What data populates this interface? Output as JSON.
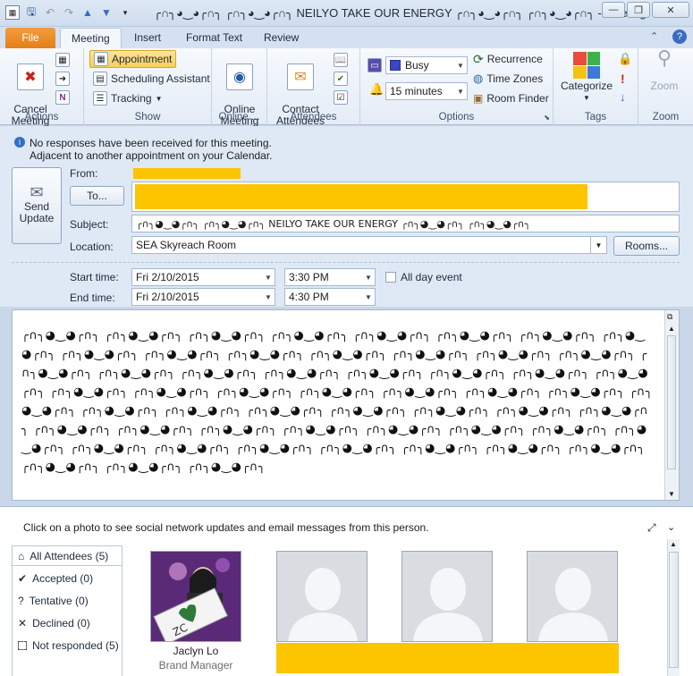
{
  "window": {
    "title": "╭∩╮◕‿◕╭∩╮ ╭∩╮◕‿◕╭∩╮ NEILYO TAKE OUR ENERGY ╭∩╮◕‿◕╭∩╮ ╭∩╮◕‿◕╭∩╮ - Meeting"
  },
  "tabs": [
    "File",
    "Meeting",
    "Insert",
    "Format Text",
    "Review"
  ],
  "ribbon": {
    "actions": {
      "cancel_label": "Cancel\nMeeting",
      "group": "Actions"
    },
    "show": {
      "appointment": "Appointment",
      "scheduling": "Scheduling Assistant",
      "tracking": "Tracking",
      "group": "Show"
    },
    "online": {
      "label": "Online\nMeeting",
      "group": "Online ..."
    },
    "attendees": {
      "contact": "Contact\nAttendees",
      "group": "Attendees"
    },
    "options": {
      "show_as": "Busy",
      "reminder": "15 minutes",
      "recurrence": "Recurrence",
      "timezones": "Time Zones",
      "roomfinder": "Room Finder",
      "group": "Options"
    },
    "tags": {
      "categorize": "Categorize",
      "group": "Tags"
    },
    "zoom": {
      "label": "Zoom",
      "group": "Zoom"
    }
  },
  "info": {
    "line1": "No responses have been received for this meeting.",
    "line2": "Adjacent to another appointment on your Calendar."
  },
  "form": {
    "send_update": "Send\nUpdate",
    "from_label": "From:",
    "to_button": "To...",
    "subject_label": "Subject:",
    "subject": "╭∩╮◕‿◕╭∩╮ ╭∩╮◕‿◕╭∩╮ NEILYO TAKE OUR ENERGY ╭∩╮◕‿◕╭∩╮ ╭∩╮◕‿◕╭∩╮",
    "location_label": "Location:",
    "location": "SEA Skyreach Room",
    "rooms_button": "Rooms...",
    "start_label": "Start time:",
    "start_date": "Fri 2/10/2015",
    "start_time": "3:30 PM",
    "allday": "All day event",
    "end_label": "End time:",
    "end_date": "Fri 2/10/2015",
    "end_time": "4:30 PM"
  },
  "body": {
    "text": "╭∩╮◕‿◕╭∩╮ ╭∩╮◕‿◕╭∩╮ ╭∩╮◕‿◕╭∩╮ ╭∩╮◕‿◕╭∩╮ ╭∩╮◕‿◕╭∩╮ ╭∩╮◕‿◕╭∩╮ ╭∩╮◕‿◕╭∩╮ ╭∩╮◕‿◕╭∩╮ ╭∩╮◕‿◕╭∩╮ ╭∩╮◕‿◕╭∩╮ ╭∩╮◕‿◕╭∩╮ ╭∩╮◕‿◕╭∩╮ ╭∩╮◕‿◕╭∩╮ ╭∩╮◕‿◕╭∩╮ ╭∩╮◕‿◕╭∩╮ ╭∩╮◕‿◕╭∩╮ ╭∩╮◕‿◕╭∩╮ ╭∩╮◕‿◕╭∩╮ ╭∩╮◕‿◕╭∩╮ ╭∩╮◕‿◕╭∩╮ ╭∩╮◕‿◕╭∩╮ ╭∩╮◕‿◕╭∩╮ ╭∩╮◕‿◕╭∩╮ ╭∩╮◕‿◕╭∩╮ ╭∩╮◕‿◕╭∩╮ ╭∩╮◕‿◕╭∩╮ ╭∩╮◕‿◕╭∩╮ ╭∩╮◕‿◕╭∩╮ ╭∩╮◕‿◕╭∩╮ ╭∩╮◕‿◕╭∩╮ ╭∩╮◕‿◕╭∩╮ ╭∩╮◕‿◕╭∩╮ ╭∩╮◕‿◕╭∩╮ ╭∩╮◕‿◕╭∩╮ ╭∩╮◕‿◕╭∩╮ ╭∩╮◕‿◕╭∩╮ ╭∩╮◕‿◕╭∩╮ ╭∩╮◕‿◕╭∩╮ ╭∩╮◕‿◕╭∩╮ ╭∩╮◕‿◕╭∩╮ ╭∩╮◕‿◕╭∩╮ ╭∩╮◕‿◕╭∩╮ ╭∩╮◕‿◕╭∩╮ ╭∩╮◕‿◕╭∩╮ ╭∩╮◕‿◕╭∩╮ ╭∩╮◕‿◕╭∩╮ ╭∩╮◕‿◕╭∩╮ ╭∩╮◕‿◕╭∩╮ ╭∩╮◕‿◕╭∩╮ ╭∩╮◕‿◕╭∩╮ ╭∩╮◕‿◕╭∩╮ ╭∩╮◕‿◕╭∩╮ ╭∩╮◕‿◕╭∩╮ ╭∩╮◕‿◕╭∩╮ ╭∩╮◕‿◕╭∩╮ ╭∩╮◕‿◕╭∩╮"
  },
  "people": {
    "hint": "Click on a photo to see social network updates and email messages from this person.",
    "list": [
      {
        "label": "All Attendees (5)",
        "icon": "person-icon"
      },
      {
        "label": "Accepted (0)",
        "icon": "check-icon"
      },
      {
        "label": "Tentative (0)",
        "icon": "question-icon"
      },
      {
        "label": "Declined (0)",
        "icon": "x-icon"
      },
      {
        "label": "Not responded (5)",
        "icon": "box-icon"
      }
    ],
    "person1_name": "Jaclyn Lo",
    "person1_title": "Brand Manager"
  },
  "colors": {
    "redact": "#fdc400",
    "file_tab": "#e8862a"
  }
}
